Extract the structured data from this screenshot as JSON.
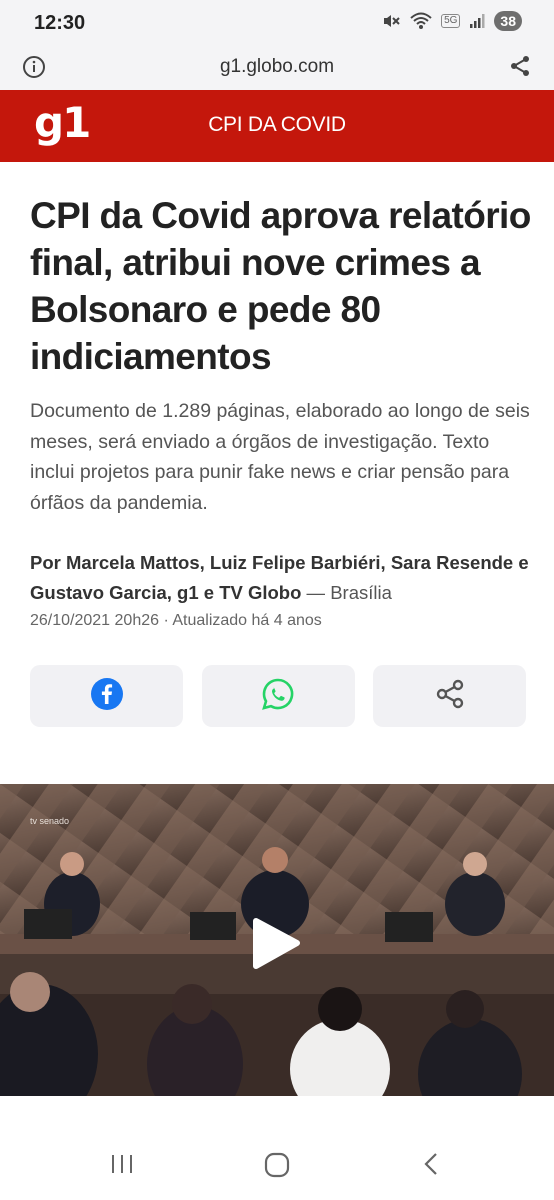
{
  "status": {
    "time": "12:30",
    "network": "5G",
    "battery": "38"
  },
  "browser": {
    "url": "g1.globo.com",
    "info_icon": "info-icon",
    "share_icon": "share-icon"
  },
  "header": {
    "logo": "g1",
    "section": "CPI DA COVID",
    "brand_color": "#c4170c"
  },
  "article": {
    "headline": "CPI da Covid aprova relatório final, atribui nove crimes a Bolsonaro e pede 80 indiciamentos",
    "subtitle": "Documento de 1.289 páginas, elaborado ao longo de seis meses, será enviado a órgãos de investigação. Texto inclui projetos para punir fake news e criar pensão para órfãos da pandemia.",
    "authors": "Por Marcela Mattos, Luiz Felipe Barbiéri, Sara Resende e Gustavo Garcia, g1 e TV Globo",
    "location": "Brasília",
    "date": "26/10/2021 20h26 · Atualizado há 4 anos"
  },
  "share_buttons": [
    {
      "icon": "facebook-icon",
      "color": "#1877f2"
    },
    {
      "icon": "whatsapp-icon",
      "color": "#25d366"
    },
    {
      "icon": "share-icon",
      "color": "#555555"
    }
  ],
  "video": {
    "watermark": "tv senado",
    "play_icon": "play-icon"
  },
  "nav": {
    "recents_icon": "recents-icon",
    "home_icon": "home-icon",
    "back_icon": "back-icon"
  }
}
